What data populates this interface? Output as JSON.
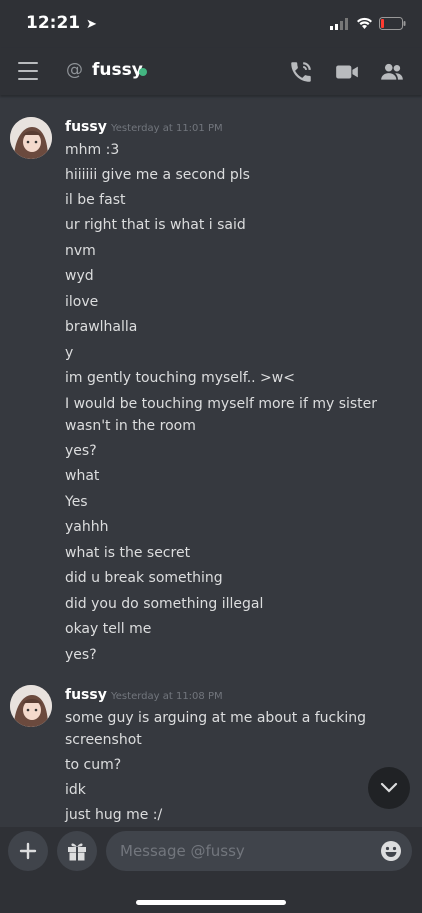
{
  "status_bar": {
    "time": "12:21"
  },
  "header": {
    "at_symbol": "@",
    "channel_name": "fussy"
  },
  "messages": [
    {
      "username": "fussy",
      "timestamp": "Yesterday at 11:01 PM",
      "lines": [
        "mhm :3",
        "hiiiiii give me a second pls",
        "il be fast",
        "ur right that is what i said",
        "nvm",
        "wyd",
        "ilove",
        "brawlhalla",
        "y",
        "im gently touching myself.. >w<",
        "I would be touching myself more if my sister wasn't in the room",
        "yes?",
        "what",
        "Yes",
        "yahhh",
        "what is the secret",
        "did u break something",
        "did you do something illegal",
        "okay tell me",
        "yes?"
      ]
    },
    {
      "username": "fussy",
      "timestamp": "Yesterday at 11:08 PM",
      "lines": [
        "some guy is arguing at me about a fucking screenshot",
        "to cum?",
        "idk",
        "just hug me :/"
      ]
    }
  ],
  "composer": {
    "placeholder": "Message @fussy"
  }
}
